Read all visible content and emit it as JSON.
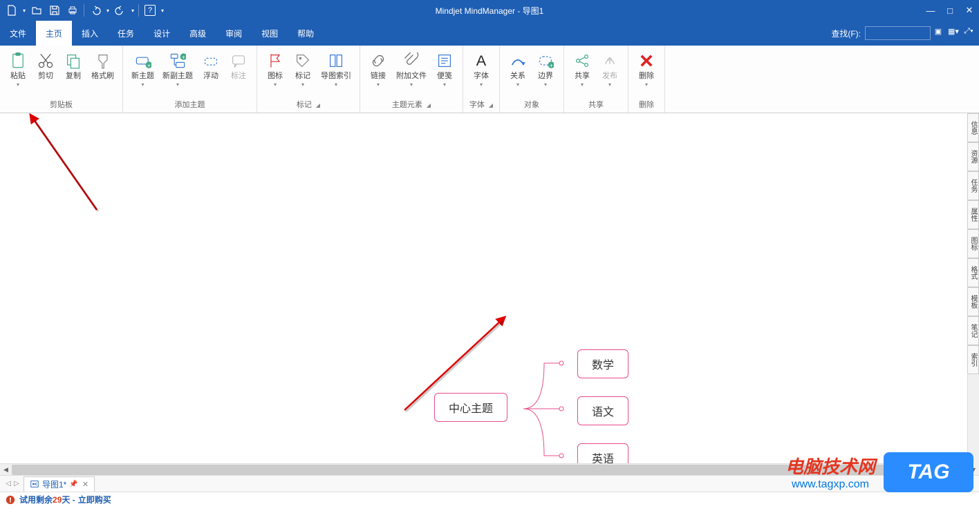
{
  "app": {
    "title": "Mindjet MindManager - 导图1"
  },
  "qat": {
    "new": "新建",
    "open": "打开",
    "save": "保存",
    "print": "打印",
    "undo": "撤销",
    "redo": "重做",
    "help": "?"
  },
  "window": {
    "min": "—",
    "max": "□",
    "close": "✕"
  },
  "menu": {
    "tabs": [
      "文件",
      "主页",
      "插入",
      "任务",
      "设计",
      "高级",
      "审阅",
      "视图",
      "帮助"
    ],
    "active_index": 1,
    "search_label": "查找(F):"
  },
  "ribbon": {
    "groups": [
      {
        "label": "剪贴板",
        "buttons": [
          {
            "label": "粘贴",
            "icon": "paste-icon",
            "drop": true
          },
          {
            "label": "剪切",
            "icon": "cut-icon"
          },
          {
            "label": "复制",
            "icon": "copy-icon"
          },
          {
            "label": "格式刷",
            "icon": "formatpainter-icon"
          }
        ]
      },
      {
        "label": "添加主题",
        "buttons": [
          {
            "label": "新主题",
            "icon": "newtopic-icon",
            "drop": true
          },
          {
            "label": "新副主题",
            "icon": "newsubtopic-icon",
            "drop": true
          },
          {
            "label": "浮动",
            "icon": "float-icon"
          },
          {
            "label": "标注",
            "icon": "callout-icon",
            "disabled": true
          }
        ]
      },
      {
        "label": "标记",
        "dlg": true,
        "buttons": [
          {
            "label": "图标",
            "icon": "flag-icon",
            "drop": true
          },
          {
            "label": "标记",
            "icon": "tag-icon",
            "drop": true
          },
          {
            "label": "导图索引",
            "icon": "index-icon",
            "drop": true
          }
        ]
      },
      {
        "label": "主题元素",
        "dlg": true,
        "buttons": [
          {
            "label": "链接",
            "icon": "link-icon",
            "drop": true
          },
          {
            "label": "附加文件",
            "icon": "attach-icon",
            "drop": true
          },
          {
            "label": "便笺",
            "icon": "note-icon",
            "drop": true
          }
        ]
      },
      {
        "label": "字体",
        "dlg": true,
        "buttons": [
          {
            "label": "字体",
            "icon": "font-icon",
            "drop": true
          }
        ]
      },
      {
        "label": "对象",
        "buttons": [
          {
            "label": "关系",
            "icon": "relation-icon",
            "drop": true
          },
          {
            "label": "边界",
            "icon": "boundary-icon",
            "drop": true
          }
        ]
      },
      {
        "label": "共享",
        "buttons": [
          {
            "label": "共享",
            "icon": "share-icon",
            "drop": true
          },
          {
            "label": "发布",
            "icon": "publish-icon",
            "disabled": true,
            "drop": true
          }
        ]
      },
      {
        "label": "删除",
        "buttons": [
          {
            "label": "删除",
            "icon": "delete-icon",
            "drop": true
          }
        ]
      }
    ]
  },
  "mindmap": {
    "central": "中心主题",
    "children": [
      "数学",
      "语文",
      "英语"
    ]
  },
  "doctab": {
    "name": "导图1*"
  },
  "status": {
    "trial_prefix": "试用剩余 ",
    "days": "29",
    "trial_mid": " 天 - ",
    "buy": "立即购买"
  },
  "watermark": {
    "text": "电脑技术网",
    "url": "www.tagxp.com",
    "tag": "TAG"
  },
  "sidepanel": [
    "信息",
    "资源",
    "任务",
    "属性",
    "图标",
    "格式",
    "模板",
    "笔记",
    "索引"
  ]
}
